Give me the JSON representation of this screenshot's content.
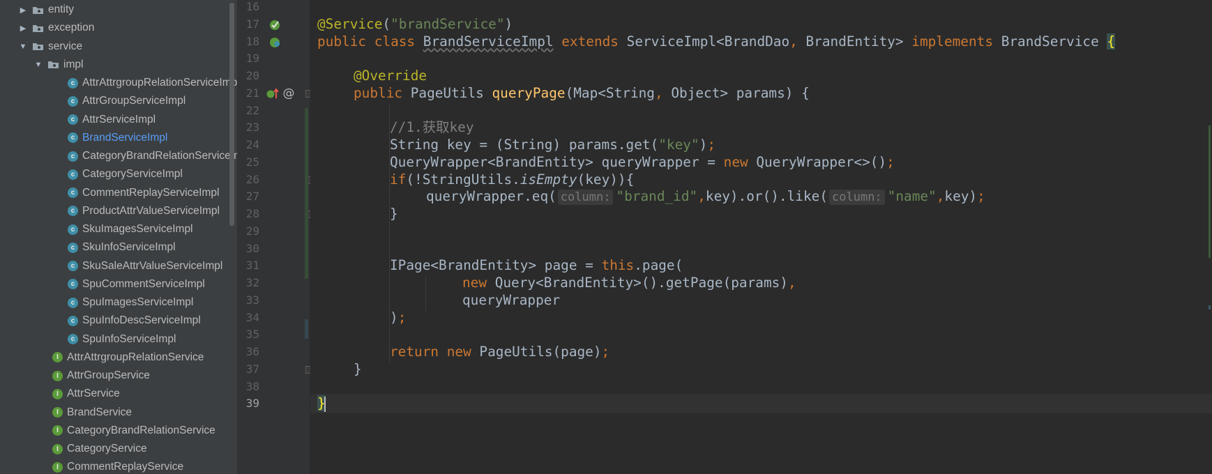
{
  "project_tree": {
    "items": [
      {
        "label": "entity",
        "kind": "folder",
        "arrow": "collapsed",
        "indent": 1
      },
      {
        "label": "exception",
        "kind": "folder",
        "arrow": "collapsed",
        "indent": 1
      },
      {
        "label": "service",
        "kind": "folder",
        "arrow": "expanded",
        "indent": 1
      },
      {
        "label": "impl",
        "kind": "folder",
        "arrow": "expanded",
        "indent": 2
      },
      {
        "label": "AttrAttrgroupRelationServiceImpl",
        "kind": "class",
        "indent": 3
      },
      {
        "label": "AttrGroupServiceImpl",
        "kind": "class",
        "indent": 3
      },
      {
        "label": "AttrServiceImpl",
        "kind": "class",
        "indent": 3
      },
      {
        "label": "BrandServiceImpl",
        "kind": "class",
        "indent": 3,
        "selected": true
      },
      {
        "label": "CategoryBrandRelationServiceImpl",
        "kind": "class",
        "indent": 3
      },
      {
        "label": "CategoryServiceImpl",
        "kind": "class",
        "indent": 3
      },
      {
        "label": "CommentReplayServiceImpl",
        "kind": "class",
        "indent": 3
      },
      {
        "label": "ProductAttrValueServiceImpl",
        "kind": "class",
        "indent": 3
      },
      {
        "label": "SkuImagesServiceImpl",
        "kind": "class",
        "indent": 3
      },
      {
        "label": "SkuInfoServiceImpl",
        "kind": "class",
        "indent": 3
      },
      {
        "label": "SkuSaleAttrValueServiceImpl",
        "kind": "class",
        "indent": 3
      },
      {
        "label": "SpuCommentServiceImpl",
        "kind": "class",
        "indent": 3
      },
      {
        "label": "SpuImagesServiceImpl",
        "kind": "class",
        "indent": 3
      },
      {
        "label": "SpuInfoDescServiceImpl",
        "kind": "class",
        "indent": 3
      },
      {
        "label": "SpuInfoServiceImpl",
        "kind": "class",
        "indent": 3
      },
      {
        "label": "AttrAttrgroupRelationService",
        "kind": "interface",
        "indent": 2
      },
      {
        "label": "AttrGroupService",
        "kind": "interface",
        "indent": 2
      },
      {
        "label": "AttrService",
        "kind": "interface",
        "indent": 2
      },
      {
        "label": "BrandService",
        "kind": "interface",
        "indent": 2
      },
      {
        "label": "CategoryBrandRelationService",
        "kind": "interface",
        "indent": 2
      },
      {
        "label": "CategoryService",
        "kind": "interface",
        "indent": 2
      },
      {
        "label": "CommentReplayService",
        "kind": "interface",
        "indent": 2
      }
    ],
    "class_icon_letter": "c",
    "interface_icon_letter": "I"
  },
  "gutter": {
    "line_numbers": [
      "16",
      "17",
      "18",
      "19",
      "20",
      "21",
      "22",
      "23",
      "24",
      "25",
      "26",
      "27",
      "28",
      "29",
      "30",
      "31",
      "32",
      "33",
      "34",
      "35",
      "36",
      "37",
      "38",
      "39"
    ],
    "current_line": "39",
    "icons": {
      "implementing_icon": "implementing-method-icon",
      "annotation_marker": "@"
    }
  },
  "editor": {
    "lines": [
      {
        "ln": "16",
        "indent": 0,
        "tokens": []
      },
      {
        "ln": "17",
        "indent": 0,
        "tokens": [
          {
            "t": "ann",
            "v": "@Service"
          },
          {
            "t": "",
            "v": "("
          },
          {
            "t": "str",
            "v": "\"brandService\""
          },
          {
            "t": "",
            "v": ")"
          }
        ]
      },
      {
        "ln": "18",
        "indent": 0,
        "tokens": [
          {
            "t": "kw",
            "v": "public class "
          },
          {
            "t": "squig",
            "v": "BrandServiceImpl"
          },
          {
            "t": "",
            "v": " "
          },
          {
            "t": "kw",
            "v": "extends "
          },
          {
            "t": "",
            "v": "ServiceImpl<BrandDao"
          },
          {
            "t": "kw",
            "v": ", "
          },
          {
            "t": "",
            "v": "BrandEntity> "
          },
          {
            "t": "kw",
            "v": "implements "
          },
          {
            "t": "",
            "v": "BrandService "
          },
          {
            "t": "brace",
            "v": "{"
          }
        ]
      },
      {
        "ln": "19",
        "indent": 0,
        "tokens": []
      },
      {
        "ln": "20",
        "indent": 1,
        "tokens": [
          {
            "t": "ann",
            "v": "@Override"
          }
        ]
      },
      {
        "ln": "21",
        "indent": 1,
        "tokens": [
          {
            "t": "kw",
            "v": "public "
          },
          {
            "t": "",
            "v": "PageUtils "
          },
          {
            "t": "fn",
            "v": "queryPage"
          },
          {
            "t": "",
            "v": "(Map<String"
          },
          {
            "t": "kw",
            "v": ", "
          },
          {
            "t": "",
            "v": "Object> params) {"
          }
        ]
      },
      {
        "ln": "22",
        "indent": 0,
        "tokens": []
      },
      {
        "ln": "23",
        "indent": 2,
        "tokens": [
          {
            "t": "cm",
            "v": "//1.获取key"
          }
        ]
      },
      {
        "ln": "24",
        "indent": 2,
        "tokens": [
          {
            "t": "",
            "v": "String key = (String) params.get("
          },
          {
            "t": "str",
            "v": "\"key\""
          },
          {
            "t": "",
            "v": ")"
          },
          {
            "t": "kw",
            "v": ";"
          }
        ]
      },
      {
        "ln": "25",
        "indent": 2,
        "tokens": [
          {
            "t": "",
            "v": "QueryWrapper<BrandEntity> queryWrapper = "
          },
          {
            "t": "kw",
            "v": "new "
          },
          {
            "t": "",
            "v": "QueryWrapper<>()"
          },
          {
            "t": "kw",
            "v": ";"
          }
        ]
      },
      {
        "ln": "26",
        "indent": 2,
        "tokens": [
          {
            "t": "kw",
            "v": "if"
          },
          {
            "t": "",
            "v": "(!StringUtils."
          },
          {
            "t": "it",
            "v": "isEmpty"
          },
          {
            "t": "",
            "v": "(key)){"
          }
        ]
      },
      {
        "ln": "27",
        "indent": 3,
        "tokens": [
          {
            "t": "",
            "v": "queryWrapper.eq("
          },
          {
            "t": "hint",
            "v": "column:"
          },
          {
            "t": "str",
            "v": "\"brand_id\""
          },
          {
            "t": "kw",
            "v": ","
          },
          {
            "t": "",
            "v": "key).or().like("
          },
          {
            "t": "hint",
            "v": "column:"
          },
          {
            "t": "str",
            "v": "\"name\""
          },
          {
            "t": "kw",
            "v": ","
          },
          {
            "t": "",
            "v": "key)"
          },
          {
            "t": "kw",
            "v": ";"
          }
        ]
      },
      {
        "ln": "28",
        "indent": 2,
        "tokens": [
          {
            "t": "",
            "v": "}"
          }
        ]
      },
      {
        "ln": "29",
        "indent": 0,
        "tokens": []
      },
      {
        "ln": "30",
        "indent": 0,
        "tokens": []
      },
      {
        "ln": "31",
        "indent": 2,
        "tokens": [
          {
            "t": "",
            "v": "IPage<BrandEntity> page = "
          },
          {
            "t": "kw",
            "v": "this"
          },
          {
            "t": "",
            "v": ".page("
          }
        ]
      },
      {
        "ln": "32",
        "indent": 4,
        "tokens": [
          {
            "t": "kw",
            "v": "new "
          },
          {
            "t": "",
            "v": "Query<BrandEntity>().getPage(params)"
          },
          {
            "t": "kw",
            "v": ","
          }
        ]
      },
      {
        "ln": "33",
        "indent": 4,
        "tokens": [
          {
            "t": "",
            "v": "queryWrapper"
          }
        ]
      },
      {
        "ln": "34",
        "indent": 2,
        "tokens": [
          {
            "t": "",
            "v": ")"
          },
          {
            "t": "kw",
            "v": ";"
          }
        ]
      },
      {
        "ln": "35",
        "indent": 0,
        "tokens": []
      },
      {
        "ln": "36",
        "indent": 2,
        "tokens": [
          {
            "t": "kw",
            "v": "return new "
          },
          {
            "t": "",
            "v": "PageUtils(page)"
          },
          {
            "t": "kw",
            "v": ";"
          }
        ]
      },
      {
        "ln": "37",
        "indent": 1,
        "tokens": [
          {
            "t": "",
            "v": "}"
          }
        ]
      },
      {
        "ln": "38",
        "indent": 0,
        "tokens": []
      },
      {
        "ln": "39",
        "indent": 0,
        "tokens": [
          {
            "t": "brace",
            "v": "}"
          },
          {
            "t": "caret",
            "v": ""
          }
        ]
      }
    ]
  },
  "colors": {
    "keyword": "#cc7832",
    "string": "#6a8759",
    "annotation": "#bbb529",
    "method": "#ffc66d",
    "comment": "#808080",
    "text": "#a9b7c6",
    "selected_tree_item": "#589df6"
  }
}
